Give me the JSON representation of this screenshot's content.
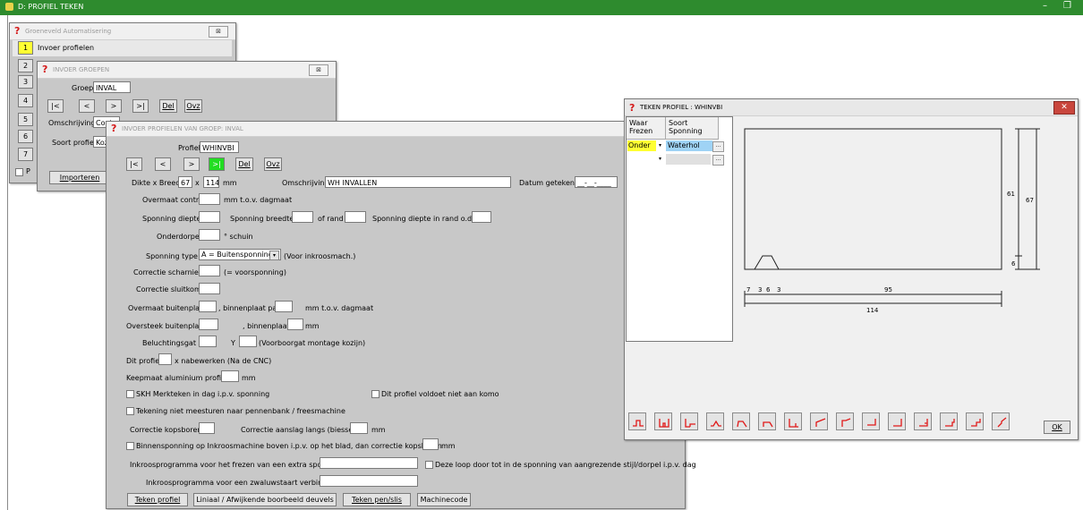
{
  "app": {
    "title": "D: PROFIEL TEKEN",
    "min_label": "–",
    "max_label": "❐"
  },
  "win_auto": {
    "title": "Groeneveld Automatisering",
    "close": "⊠",
    "item1_num": "1",
    "item1_label": "Invoer profielen",
    "nums": [
      "2",
      "3",
      "4",
      "5",
      "6",
      "7"
    ],
    "chk_label": "P"
  },
  "win_groep": {
    "title": "INVOER GROEPEN",
    "close": "⊠",
    "groep_label": "Groep",
    "groep_value": "INVAL",
    "nav": [
      "|<",
      "<",
      ">",
      ">|"
    ],
    "del": "Del",
    "ovz": "Ovz",
    "omschrijving_label": "Omschrijving",
    "omschrijving_value": "Contra",
    "soort_label": "Soort profiel",
    "soort_value": "Kozijn",
    "importeren": "Importeren"
  },
  "win_profiel": {
    "title": "INVOER PROFIELEN VAN GROEP: INVAL",
    "profiel_label": "Profiel",
    "profiel_value": "WHINVBI",
    "nav": [
      "|<",
      "<",
      ">",
      ">|"
    ],
    "del": "Del",
    "ovz": "Ovz",
    "dikte_label": "Dikte x Breedte",
    "dikte_value": "67",
    "x_label": "x",
    "breedte_value": "114",
    "mm": "mm",
    "omschrijving_label": "Omschrijving",
    "omschrijving_value": "WH INVALLEN",
    "datum_label": "Datum getekend",
    "datum_value": "__-__-____",
    "overmaat_contra_label": "Overmaat contra",
    "tov_dagmaat": "mm  t.o.v. dagmaat",
    "sponning_diepte_label": "Sponning diepte",
    "sponning_breedte_label": "Sponning breedte",
    "of_rand_label": "of rand",
    "sponning_diepte_rand_label": "Sponning diepte in rand o.do",
    "onderdorpel_label": "Onderdorpel",
    "schuin_label": "° schuin",
    "sponning_type_label": "Sponning type",
    "sponning_type_value": "A = Buitensponning",
    "sponning_type_note": "(Voor inkroosmach.)",
    "correctie_scharnier_label": "Correctie scharnier",
    "voorsponning_label": "(= voorsponning)",
    "correctie_sluitkom_label": "Correctie sluitkom",
    "overmaat_buitenplaat_label": "Overmaat buitenplaat",
    "binnenplaat_paneel_label": ", binnenplaat paneel",
    "mm_tov_dagmaat": "mm  t.o.v. dagmaat",
    "oversteek_buitenplaat_label": "Oversteek buitenplaat",
    "binnenplaat_label": ", binnenplaat",
    "beluchtingsgat_label": "Beluchtingsgat X",
    "y_label": "Y",
    "voorboorgat_label": "(Voorboorgat montage kozijn)",
    "dit_profiel_label": "Dit profiel",
    "nabewerken_label": "x nabewerken (Na de CNC)",
    "keepmaat_label": "Keepmaat aluminium profiel",
    "skh_label": "SKH Merkteken in dag i.p.v. sponning",
    "komo_label": "Dit profiel voldoet niet aan komo",
    "tekening_label": "Tekening niet meesturen naar pennenbank / freesmachine",
    "correctie_kopsboren_label": "Correctie kopsboren",
    "correctie_aanslag_label": "Correctie aanslag langs (biesse)",
    "binnensponning_label": "Binnensponning op Inkroosmachine boven i.p.v. op het blad, dan correctie kopsboren",
    "inkroos_extra_label": "Inkroosprogramma voor het frezen van een extra sponning",
    "deze_loop_label": "Deze loop door tot in de sponning van aangrezende stijl/dorpel i.p.v. dag",
    "inkroos_zwaluw_label": "Inkroosprogramma voor een zwaluwstaart verbinding",
    "btn_teken_profiel": "Teken profiel",
    "btn_liniaal": "Liniaal / Afwijkende boorbeeld deuvels",
    "btn_teken_pen": "Teken pen/slis",
    "btn_machinecode": "Machinecode"
  },
  "win_teken": {
    "title": "TEKEN PROFIEL : WHINVBI",
    "close": "✕",
    "col1_header": "Waar Frezen",
    "col2_header": "Soort Sponning",
    "rows": [
      {
        "waar": "Onder",
        "soort": "Waterhol"
      },
      {
        "waar": "",
        "soort": ""
      }
    ],
    "dims": {
      "h61": "61",
      "h67": "67",
      "h6": "6",
      "w7": "7",
      "w3a": "3",
      "w6": "6",
      "w3b": "3",
      "w95": "95",
      "w114": "114"
    },
    "tools": [
      "profile-1",
      "profile-2",
      "profile-3",
      "profile-4",
      "profile-5",
      "profile-6",
      "profile-7",
      "profile-8",
      "profile-9",
      "profile-10",
      "profile-11",
      "profile-12",
      "profile-13",
      "profile-14",
      "profile-15"
    ],
    "ok": "OK",
    "accent_red": "#e01818"
  }
}
